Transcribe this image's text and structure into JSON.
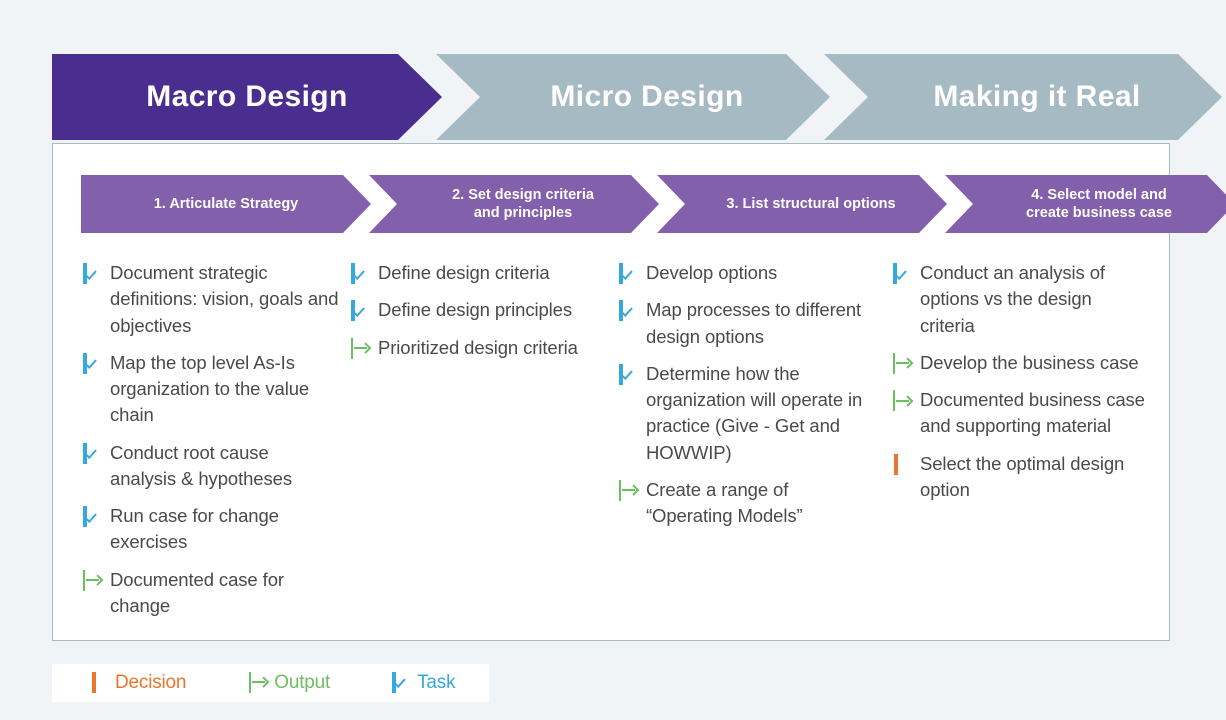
{
  "phases": [
    {
      "label": "Macro Design",
      "color": "#4a2e8f",
      "active": true
    },
    {
      "label": "Micro Design",
      "color": "#a6bac4",
      "active": false
    },
    {
      "label": "Making it Real",
      "color": "#a6bac4",
      "active": false
    }
  ],
  "steps": [
    {
      "label": "1. Articulate Strategy"
    },
    {
      "label": "2. Set design criteria\nand principles"
    },
    {
      "label": "3. List structural options"
    },
    {
      "label": "4. Select model and\ncreate business case"
    }
  ],
  "step_color": "#8260ab",
  "columns": [
    {
      "items": [
        {
          "icon": "task-icon",
          "text": "Document strategic definitions: vision, goals and objectives"
        },
        {
          "icon": "task-icon",
          "text": "Map the top level As-Is organization to the value chain"
        },
        {
          "icon": "task-icon",
          "text": "Conduct root cause analysis & hypotheses"
        },
        {
          "icon": "task-icon",
          "text": "Run case for change exercises"
        },
        {
          "icon": "output-icon",
          "text": "Documented case for change"
        }
      ]
    },
    {
      "items": [
        {
          "icon": "task-icon",
          "text": "Define design criteria"
        },
        {
          "icon": "task-icon",
          "text": "Define design principles"
        },
        {
          "icon": "output-icon",
          "text": "Prioritized design criteria"
        }
      ]
    },
    {
      "items": [
        {
          "icon": "task-icon",
          "text": "Develop options"
        },
        {
          "icon": "task-icon",
          "text": "Map processes to different design options"
        },
        {
          "icon": "task-icon",
          "text": "Determine how the organization will operate in practice (Give - Get and HOWWIP)"
        },
        {
          "icon": "output-icon",
          "text": "Create a range of “Operating Models”"
        }
      ]
    },
    {
      "items": [
        {
          "icon": "task-icon",
          "text": "Conduct an analysis of options vs the design criteria"
        },
        {
          "icon": "output-icon",
          "text": "Develop the business case"
        },
        {
          "icon": "output-icon",
          "text": "Documented business case and supporting material"
        },
        {
          "icon": "decision-icon",
          "text": "Select the optimal design option"
        }
      ]
    }
  ],
  "legend": [
    {
      "icon": "decision-icon",
      "label": "Decision",
      "color": "#e8762c"
    },
    {
      "icon": "output-icon",
      "label": "Output",
      "color": "#6cbe63"
    },
    {
      "icon": "task-icon",
      "label": "Task",
      "color": "#35a8e0"
    }
  ]
}
